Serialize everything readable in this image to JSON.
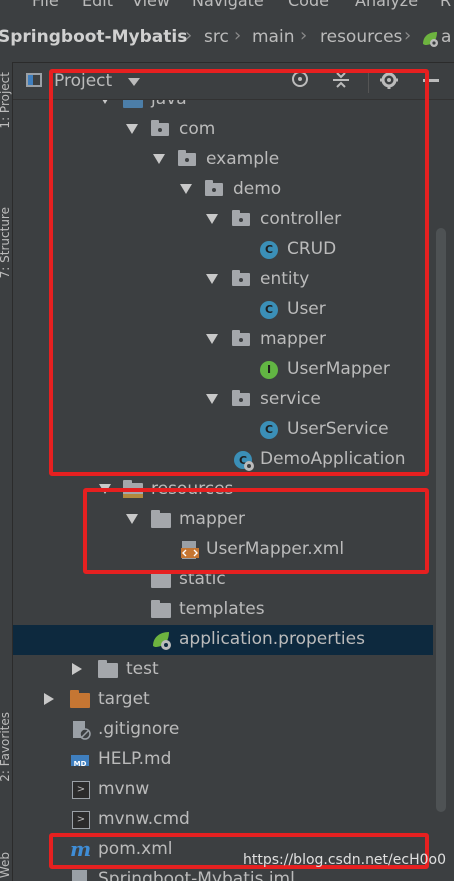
{
  "menubar": [
    "File",
    "Edit",
    "View",
    "Navigate",
    "Code",
    "Analyze",
    "R"
  ],
  "breadcrumb": {
    "project": "Springboot-Mybatis",
    "items": [
      "src",
      "main",
      "resources",
      "a"
    ]
  },
  "left_stripe": {
    "project_tab": "1: Project",
    "structure_tab": "7: Structure",
    "favorites_tab": "2: Favorites",
    "web_tab": "Web"
  },
  "panel": {
    "title": "Project",
    "dropdown_icon": "chevron-down-icon",
    "tool_icons": [
      "locate-icon",
      "collapse-all-icon",
      "gear-icon"
    ]
  },
  "tree": [
    {
      "label": "java",
      "icon": "source-folder-icon"
    },
    {
      "label": "com",
      "icon": "package-icon"
    },
    {
      "label": "example",
      "icon": "package-icon"
    },
    {
      "label": "demo",
      "icon": "package-icon"
    },
    {
      "label": "controller",
      "icon": "package-icon"
    },
    {
      "label": "CRUD",
      "icon": "class-icon",
      "badge": "C"
    },
    {
      "label": "entity",
      "icon": "package-icon"
    },
    {
      "label": "User",
      "icon": "class-icon",
      "badge": "C"
    },
    {
      "label": "mapper",
      "icon": "package-icon"
    },
    {
      "label": "UserMapper",
      "icon": "interface-icon",
      "badge": "I"
    },
    {
      "label": "service",
      "icon": "package-icon"
    },
    {
      "label": "UserService",
      "icon": "class-icon",
      "badge": "C"
    },
    {
      "label": "DemoApplication",
      "icon": "spring-boot-app-icon"
    },
    {
      "label": "resources",
      "icon": "resources-folder-icon"
    },
    {
      "label": "mapper",
      "icon": "folder-icon"
    },
    {
      "label": "UserMapper.xml",
      "icon": "xml-file-icon"
    },
    {
      "label": "static",
      "icon": "folder-icon"
    },
    {
      "label": "templates",
      "icon": "folder-icon"
    },
    {
      "label": "application.properties",
      "icon": "spring-properties-icon"
    },
    {
      "label": "test",
      "icon": "folder-icon"
    },
    {
      "label": "target",
      "icon": "excluded-folder-icon"
    },
    {
      "label": ".gitignore",
      "icon": "gitignore-file-icon"
    },
    {
      "label": "HELP.md",
      "icon": "markdown-file-icon",
      "badge": "MD"
    },
    {
      "label": "mvnw",
      "icon": "shell-file-icon"
    },
    {
      "label": "mvnw.cmd",
      "icon": "cmd-file-icon"
    },
    {
      "label": "pom.xml",
      "icon": "maven-file-icon",
      "badge": "m"
    },
    {
      "label": "Springboot-Mybatis.iml",
      "icon": "iml-file-icon"
    }
  ],
  "watermark": "https://blog.csdn.net/ecH0o0",
  "colors": {
    "background": "#3c3f41",
    "selection": "#0d293e",
    "highlight_box": "#e62020",
    "class_icon": "#3b8fb7",
    "interface_icon": "#62b543",
    "excluded_folder": "#c57633",
    "text": "#bbbbbb"
  }
}
